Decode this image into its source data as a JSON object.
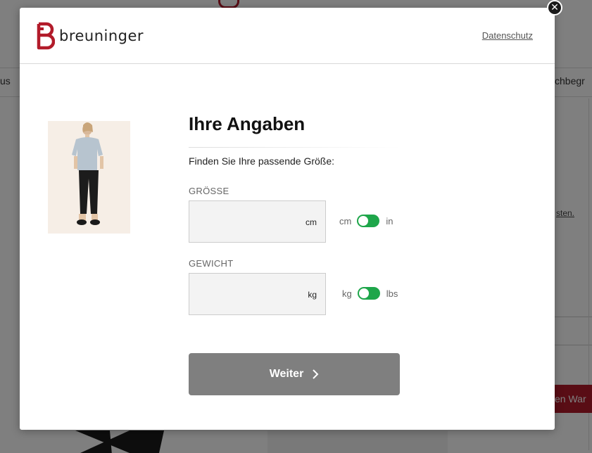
{
  "background": {
    "nav_left": "us",
    "nav_right": "chbegr",
    "link_text": "sten.",
    "red_button": "en War"
  },
  "header": {
    "logo_text": "breuninger",
    "privacy_link": "Datenschutz"
  },
  "form": {
    "title": "Ihre Angaben",
    "subtitle": "Finden Sie Ihre passende Größe:",
    "height": {
      "label": "GRÖSSE",
      "value": "",
      "unit": "cm",
      "toggle_left": "cm",
      "toggle_right": "in"
    },
    "weight": {
      "label": "GEWICHT",
      "value": "",
      "unit": "kg",
      "toggle_left": "kg",
      "toggle_right": "lbs"
    },
    "submit_label": "Weiter"
  },
  "colors": {
    "brand_red": "#b21b2a",
    "toggle_green": "#1ea64a",
    "button_gray": "#7f7f7f"
  },
  "icons": {
    "close": "close-icon",
    "chevron": "chevron-right-icon",
    "logo": "breuninger-b-logo"
  }
}
